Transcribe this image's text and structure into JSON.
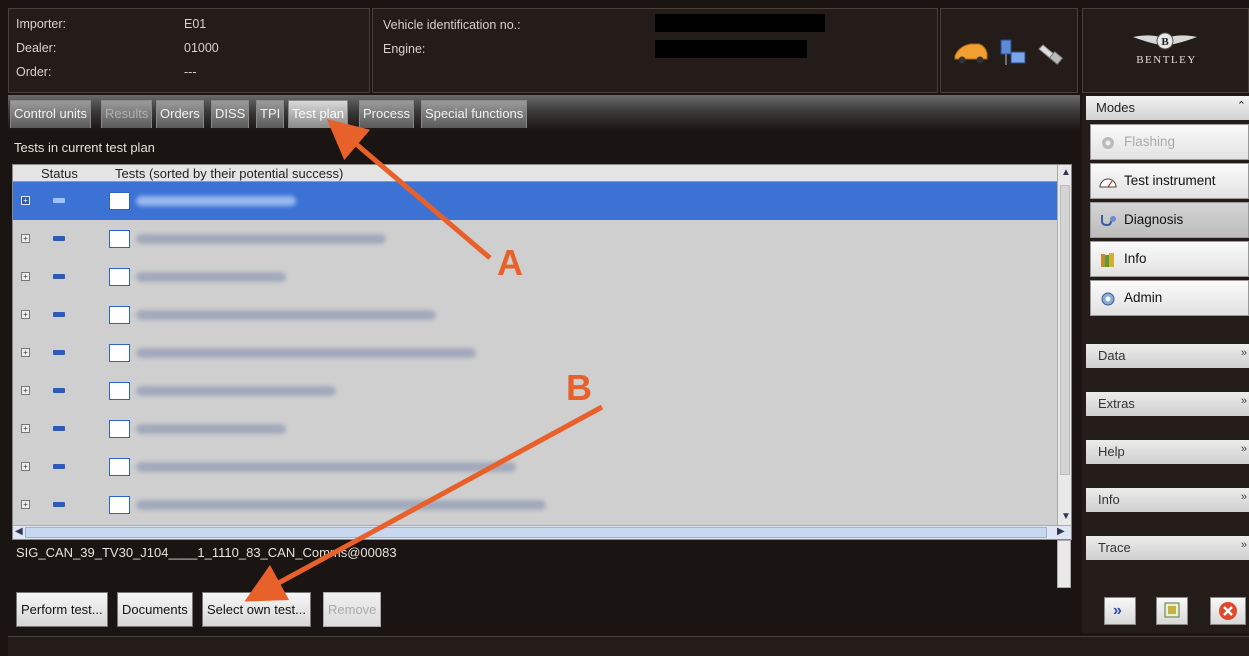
{
  "header": {
    "importer_label": "Importer:",
    "importer_value": "E01",
    "dealer_label": "Dealer:",
    "dealer_value": "01000",
    "order_label": "Order:",
    "order_value": "---",
    "vin_label": "Vehicle identification no.:",
    "engine_label": "Engine:",
    "brand": "BENTLEY"
  },
  "tabs": [
    {
      "label": "Control units"
    },
    {
      "label": "Results"
    },
    {
      "label": "Orders"
    },
    {
      "label": "DISS"
    },
    {
      "label": "TPI"
    },
    {
      "label": "Test plan"
    },
    {
      "label": "Process"
    },
    {
      "label": "Special functions"
    }
  ],
  "main": {
    "section_label": "Tests in current test plan",
    "col_status": "Status",
    "col_tests": "Tests (sorted by their potential success)",
    "status_line": "SIG_CAN_39_TV30_J104____1_1110_83_CAN_Comms@00083"
  },
  "buttons": {
    "perform": "Perform test...",
    "documents": "Documents",
    "select_own": "Select own test...",
    "remove": "Remove"
  },
  "right_panel": {
    "modes": "Modes",
    "flashing": "Flashing",
    "test_instrument": "Test instrument",
    "diagnosis": "Diagnosis",
    "info": "Info",
    "admin": "Admin",
    "data": "Data",
    "extras": "Extras",
    "help": "Help",
    "info2": "Info",
    "trace": "Trace"
  },
  "annotations": {
    "a": "A",
    "b": "B"
  },
  "colors": {
    "selection": "#3b72d4",
    "annotation": "#e8602a",
    "background": "#1a1412"
  }
}
